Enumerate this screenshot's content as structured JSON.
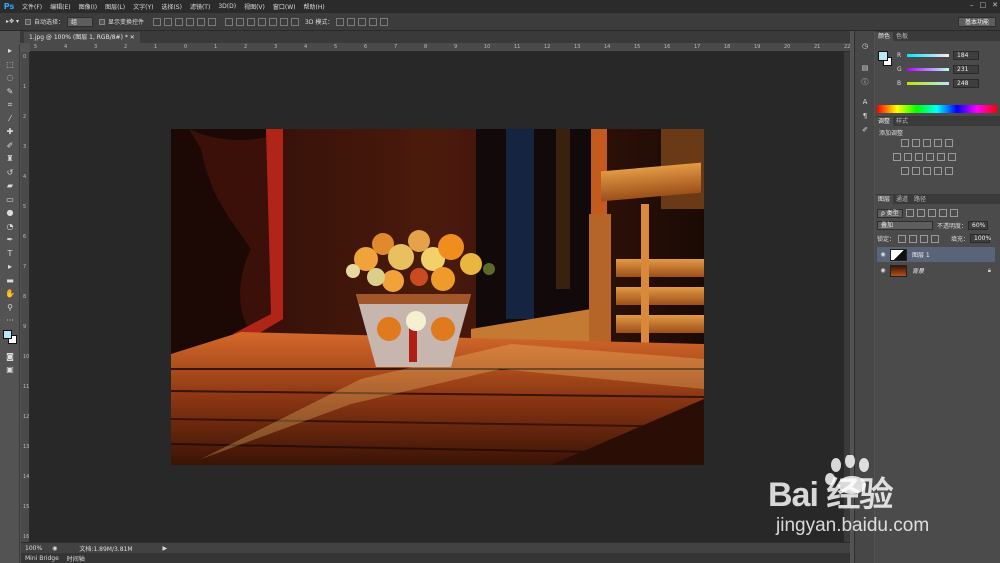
{
  "app": {
    "logo": "Ps"
  },
  "menu": [
    "文件(F)",
    "编辑(E)",
    "图像(I)",
    "图层(L)",
    "文字(Y)",
    "选择(S)",
    "滤镜(T)",
    "3D(D)",
    "视图(V)",
    "窗口(W)",
    "帮助(H)"
  ],
  "options": {
    "auto_select_label": "自动选择：",
    "auto_select_value": "组",
    "show_transform_label": "显示变换控件",
    "mode_3d_label": "3D 模式：",
    "workspace": "基本功能"
  },
  "document": {
    "tab_title": "1.jpg @ 100% (图层 1, RGB/8#) *",
    "zoom": "100%",
    "doc_info": "文档:1.89M/3.81M"
  },
  "bottom_tabs": [
    "Mini Bridge",
    "时间轴"
  ],
  "colors": {
    "foreground": "#b8e7f8",
    "background": "#ffffff"
  },
  "color_panel": {
    "tabs": [
      "颜色",
      "色板"
    ],
    "r_label": "R",
    "r_value": "184",
    "g_label": "G",
    "g_value": "231",
    "b_label": "B",
    "b_value": "248"
  },
  "adjustments_panel": {
    "tabs": [
      "调整",
      "样式"
    ],
    "title": "添加调整"
  },
  "layers_panel": {
    "tabs": [
      "图层",
      "通道",
      "路径"
    ],
    "filter_type": "ρ 类型",
    "blend_mode": "叠加",
    "opacity_label": "不透明度：",
    "opacity_value": "60%",
    "lock_label": "锁定：",
    "fill_label": "填充：",
    "fill_value": "100%",
    "layers": [
      {
        "name": "图层 1",
        "selected": true
      },
      {
        "name": "背景",
        "locked": true
      }
    ]
  },
  "watermark": {
    "logo": "Bai 经验",
    "url": "jingyan.baidu.com"
  }
}
